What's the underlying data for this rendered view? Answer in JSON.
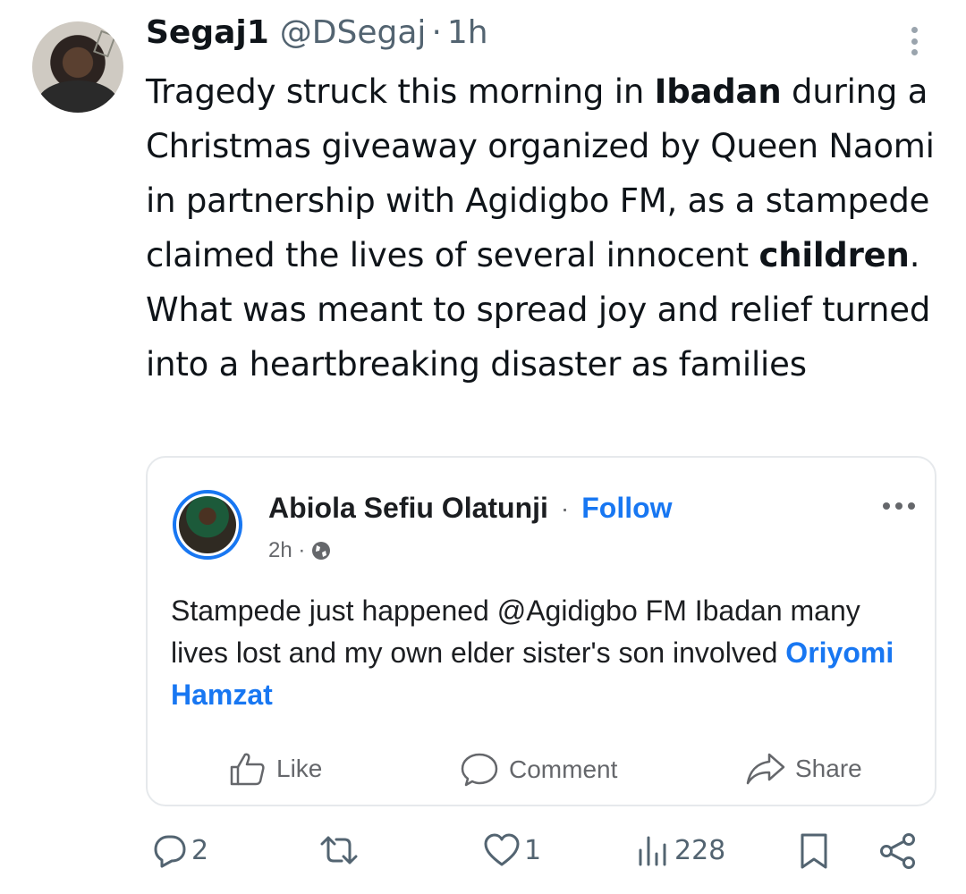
{
  "tweet": {
    "author_name": "Segaj1",
    "handle": "@DSegaj",
    "separator": "·",
    "time": "1h",
    "text_parts": {
      "p1": "Tragedy struck this morning in ",
      "b1": "Ibadan",
      "p2": " during a Christmas giveaway organized by Queen Naomi in partnership with Agidigbo FM, as a stampede claimed the lives of several innocent ",
      "b2": "children",
      "p3": ". What was meant to spread joy and relief turned into a heartbreaking disaster as families"
    }
  },
  "embed": {
    "author_name": "Abiola Sefiu Olatunji",
    "separator": "·",
    "follow_label": "Follow",
    "time": "2h ·",
    "text_plain": "Stampede just happened @Agidigbo FM Ibadan many lives lost and my own elder sister's son involved ",
    "text_link": "Oriyomi Hamzat",
    "actions": {
      "like": "Like",
      "comment": "Comment",
      "share": "Share"
    },
    "accent_color": "#1877f2"
  },
  "engagement": {
    "replies": "2",
    "likes": "1",
    "views": "228"
  },
  "icons": [
    "more-icon",
    "globe-icon",
    "thumbs-up-icon",
    "comment-icon",
    "share-arrow-icon",
    "reply-icon",
    "retweet-icon",
    "heart-icon",
    "views-icon",
    "bookmark-icon",
    "share-icon"
  ]
}
